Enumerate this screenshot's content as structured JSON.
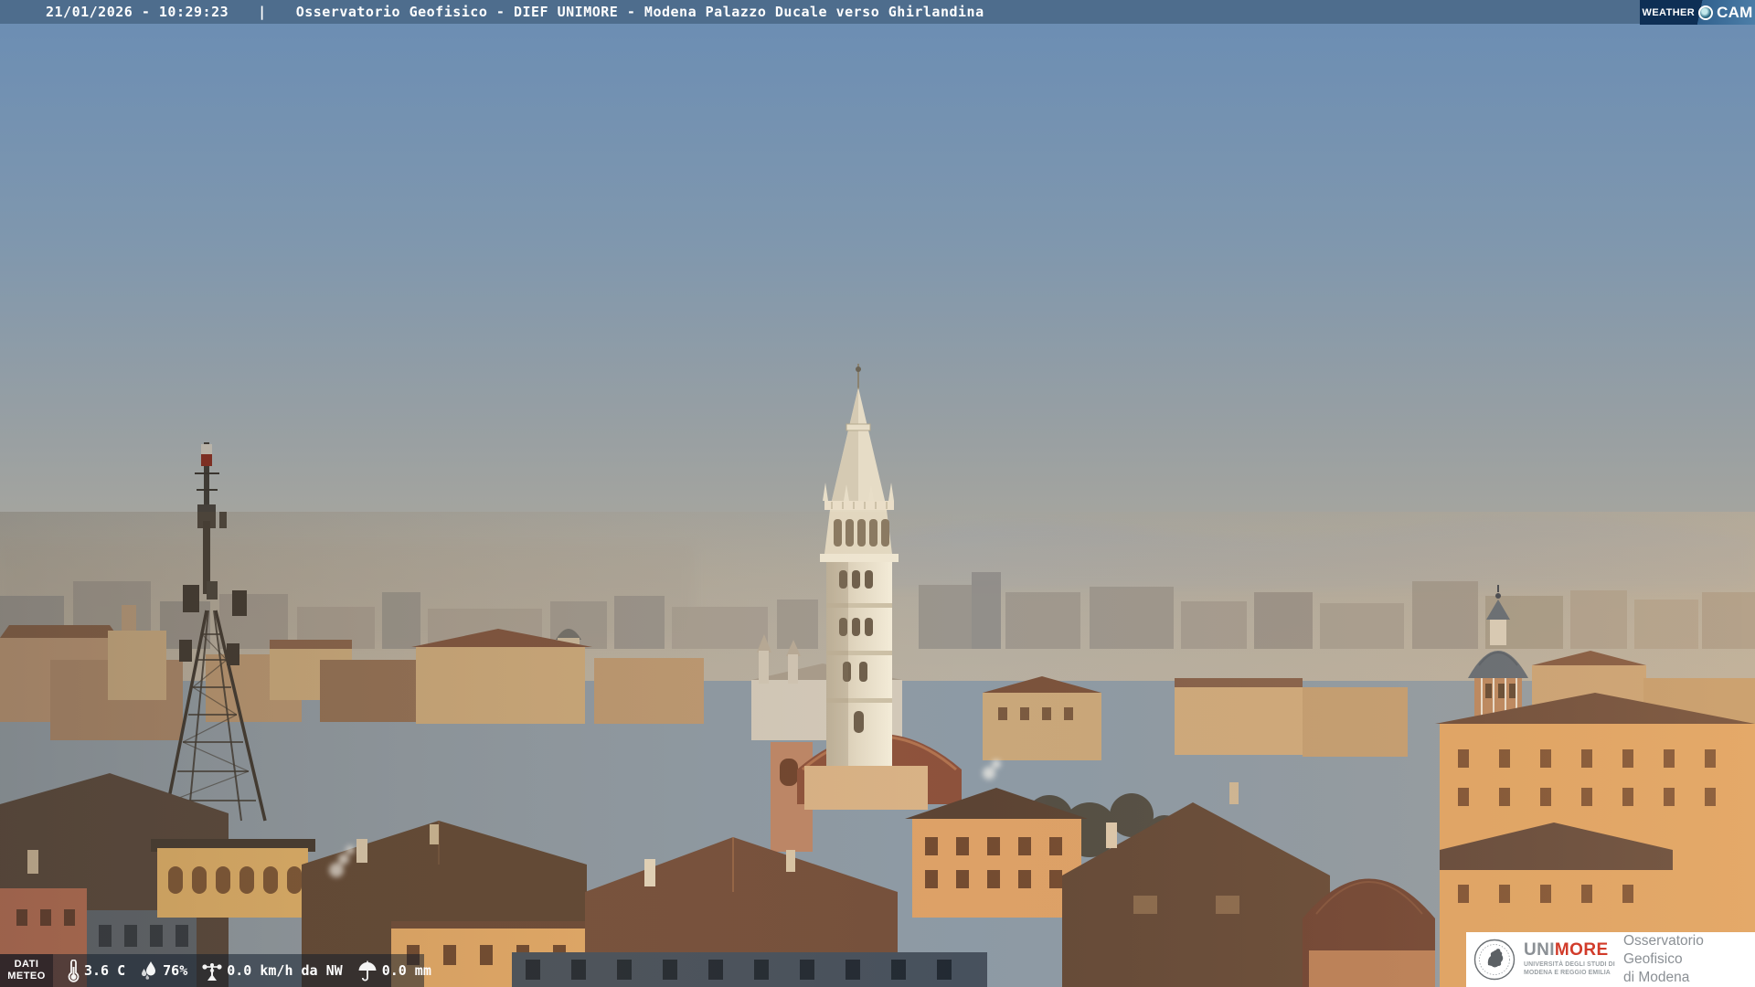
{
  "header": {
    "timestamp": "21/01/2026 - 10:29:23",
    "separator": "|",
    "title": "Osservatorio Geofisico - DIEF UNIMORE - Modena Palazzo Ducale verso Ghirlandina"
  },
  "weathercam_logo": {
    "weather": "WEATHER",
    "cam": "CAM"
  },
  "weather_bar": {
    "label_line1": "DATI",
    "label_line2": "METEO",
    "temperature": "3.6 C",
    "humidity": "76%",
    "wind": "0.0 km/h da NW",
    "precipitation": "0.0 mm"
  },
  "footer_logo": {
    "uni": "UNI",
    "more": "MORE",
    "university_line1": "UNIVERSITÀ DEGLI STUDI DI",
    "university_line2": "MODENA E REGGIO EMILIA",
    "observatory_line1": "Osservatorio Geofisico",
    "observatory_line2": "di Modena"
  },
  "colors": {
    "header_bar": "#4e6d8d",
    "logo_navy": "#0e2f55",
    "unimore_red": "#d13b2a",
    "unimore_gray": "#8b9095",
    "sky_top": "#6a8db4",
    "sky_horizon": "#b6ae9f"
  }
}
